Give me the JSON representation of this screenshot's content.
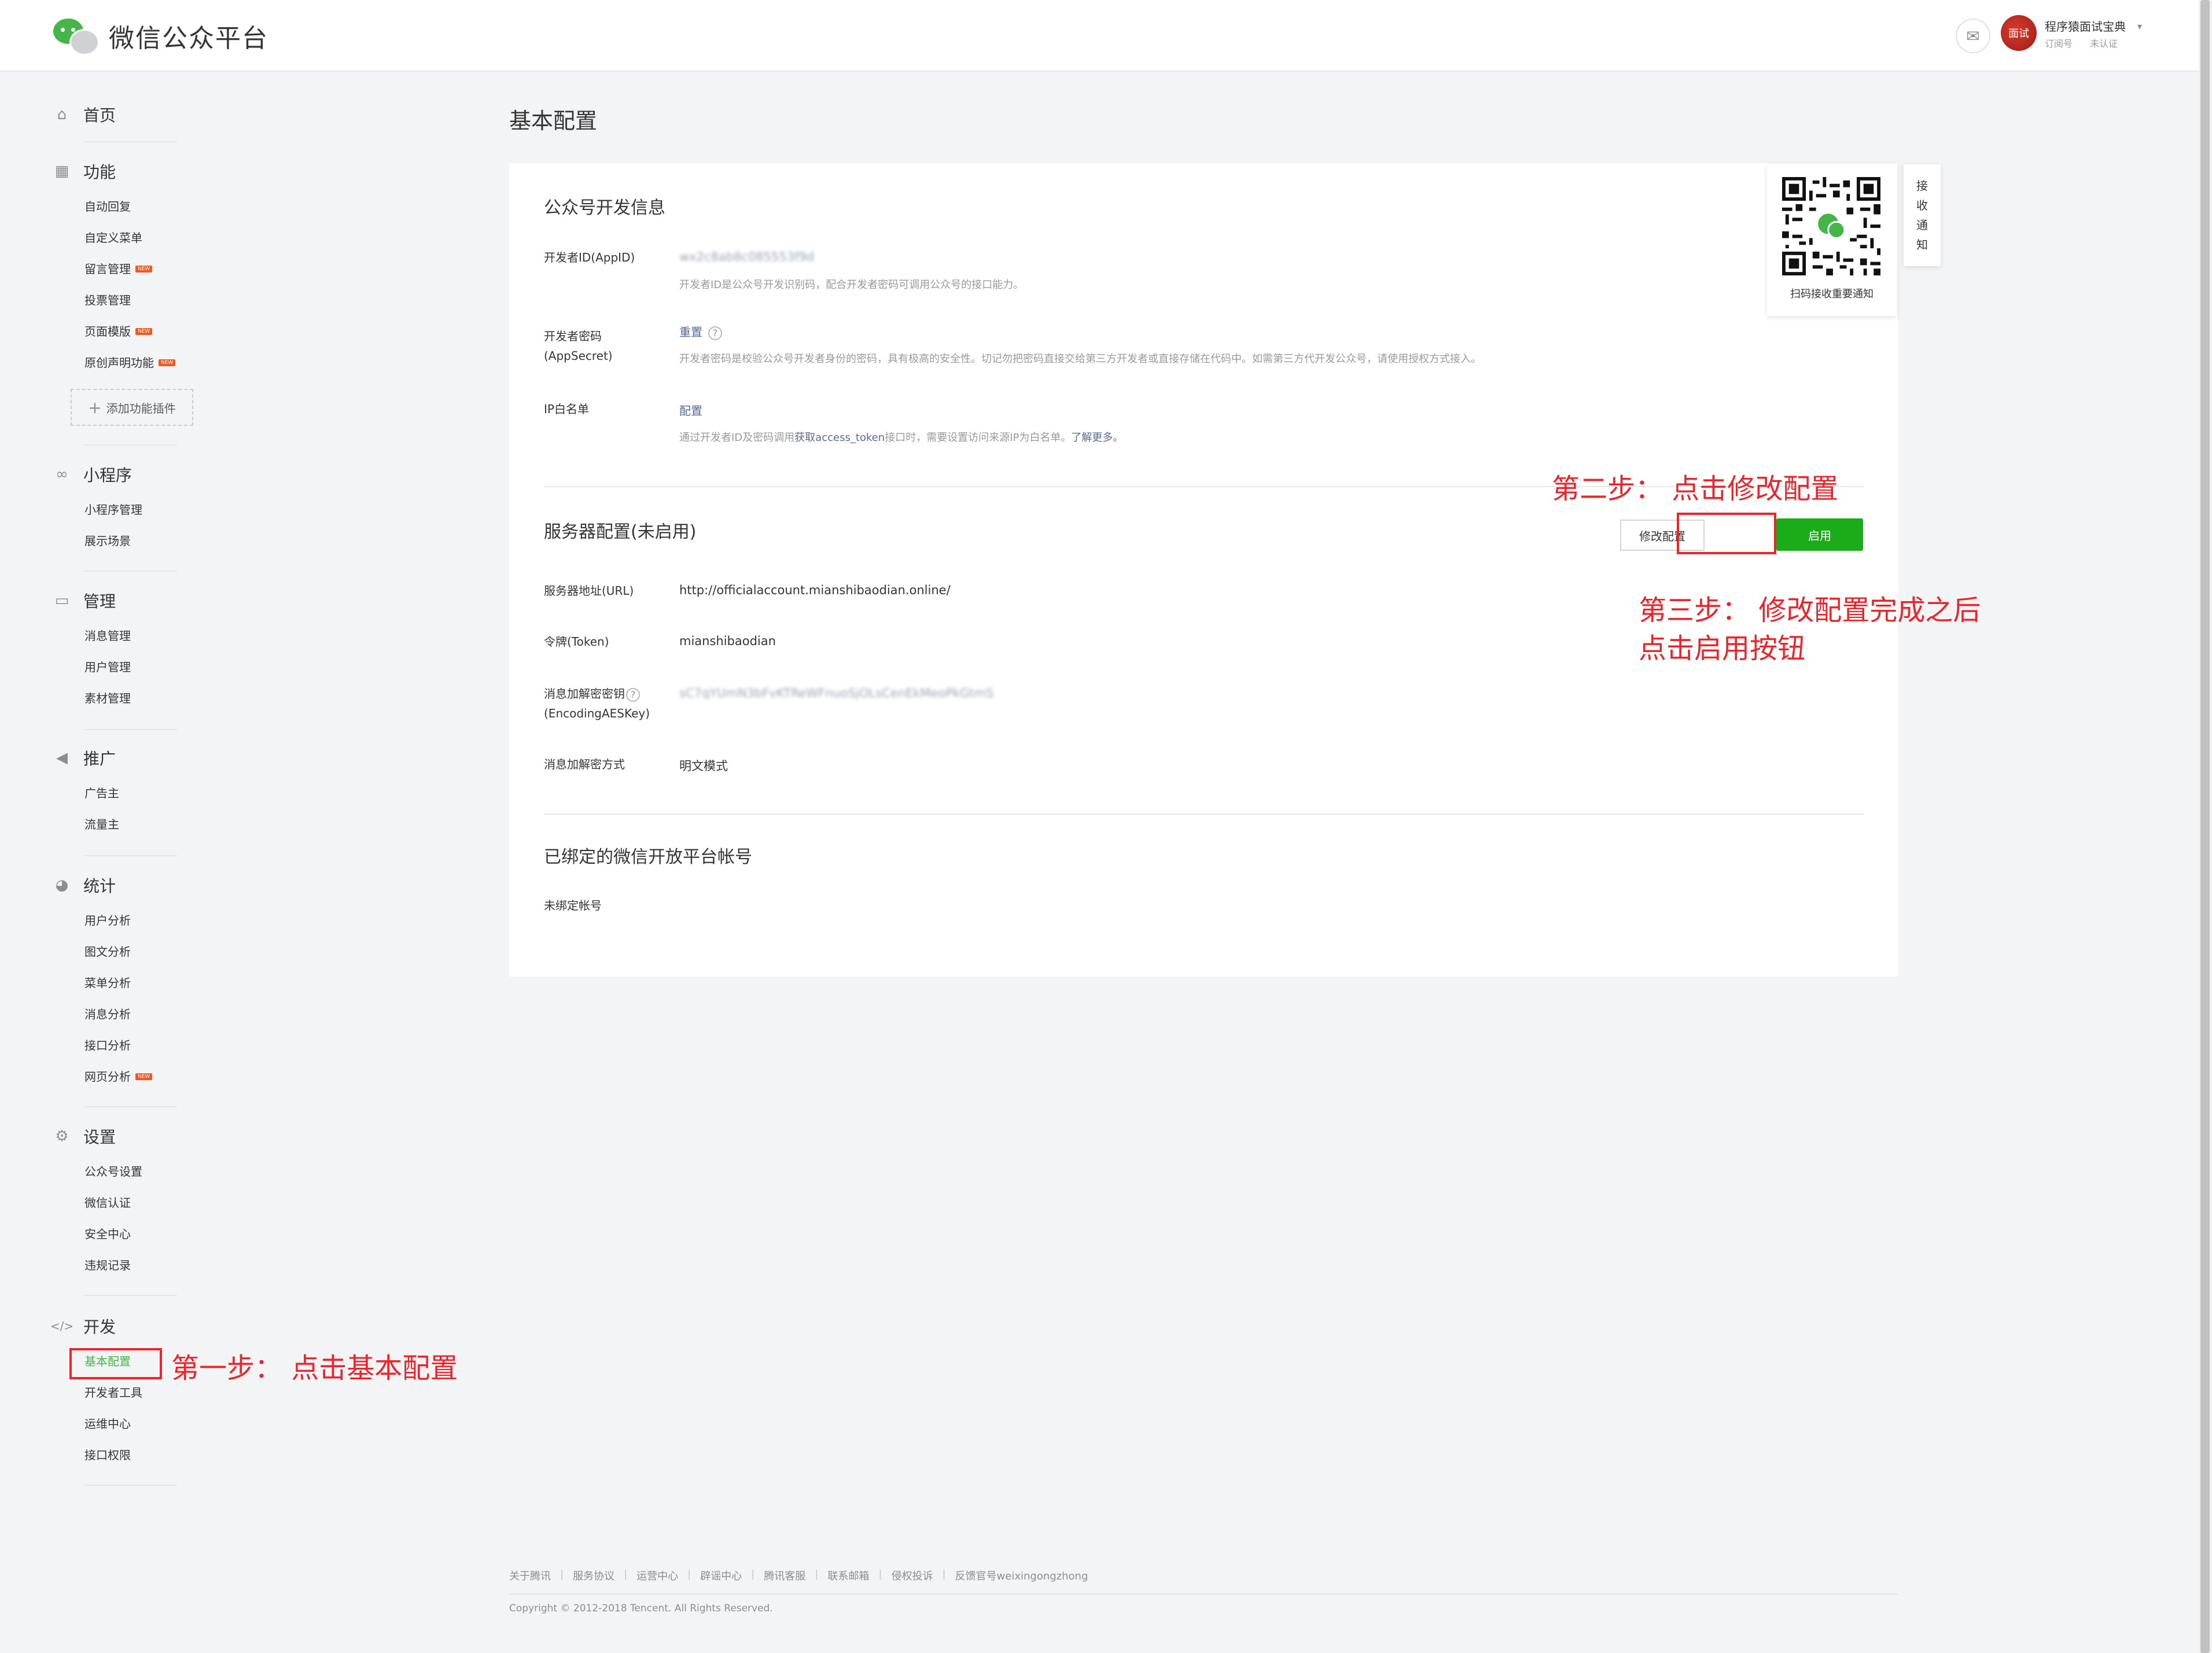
{
  "header": {
    "logo_text": "微信公众平台",
    "account": {
      "name": "程序猿面试宝典",
      "type": "订阅号",
      "verify_status": "未认证",
      "avatar_text": "面试"
    }
  },
  "sidebar": {
    "home": "首页",
    "function": {
      "label": "功能",
      "items": [
        "自动回复",
        "自定义菜单",
        "留言管理",
        "投票管理",
        "页面模版",
        "原创声明功能"
      ],
      "add_plugin": "添加功能插件"
    },
    "miniprogram": {
      "label": "小程序",
      "items": [
        "小程序管理",
        "展示场景"
      ]
    },
    "manage": {
      "label": "管理",
      "items": [
        "消息管理",
        "用户管理",
        "素材管理"
      ]
    },
    "promote": {
      "label": "推广",
      "items": [
        "广告主",
        "流量主"
      ]
    },
    "stats": {
      "label": "统计",
      "items": [
        "用户分析",
        "图文分析",
        "菜单分析",
        "消息分析",
        "接口分析",
        "网页分析"
      ]
    },
    "settings": {
      "label": "设置",
      "items": [
        "公众号设置",
        "微信认证",
        "安全中心",
        "违规记录"
      ]
    },
    "develop": {
      "label": "开发",
      "items": [
        "基本配置",
        "开发者工具",
        "运维中心",
        "接口权限"
      ]
    },
    "new_badge": "NEW"
  },
  "main": {
    "title": "基本配置",
    "dev_info": {
      "title": "公众号开发信息",
      "appid_label": "开发者ID(AppID)",
      "appid_value": "wx2c8ab8c085553f9d",
      "appid_tip": "开发者ID是公众号开发识别码，配合开发者密码可调用公众号的接口能力。",
      "secret_label_1": "开发者密码",
      "secret_label_2": "(AppSecret)",
      "secret_action": "重置",
      "secret_tip": "开发者密码是校验公众号开发者身份的密码，具有极高的安全性。切记勿把密码直接交给第三方开发者或直接存储在代码中。如需第三方代开发公众号，请使用授权方式接入。",
      "ip_label": "IP白名单",
      "ip_action": "配置",
      "ip_tip_1": "通过开发者ID及密码调用",
      "ip_tip_link": "获取access_token",
      "ip_tip_2": "接口时，需要设置访问来源IP为白名单。",
      "ip_tip_more": "了解更多。"
    },
    "server": {
      "title": "服务器配置(未启用)",
      "edit_button": "修改配置",
      "enable_button": "启用",
      "url_label": "服务器地址(URL)",
      "url_value": "http://officialaccount.mianshibaodian.online/",
      "token_label": "令牌(Token)",
      "token_value": "mianshibaodian",
      "aes_label_1": "消息加解密密钥",
      "aes_label_2": "(EncodingAESKey)",
      "aes_value": "sC7qYUmN3bFvKTReWFnuoSjOLsCenEkMeoPkGtmS",
      "mode_label": "消息加解密方式",
      "mode_value": "明文模式"
    },
    "open_platform": {
      "title": "已绑定的微信开放平台帐号",
      "value": "未绑定帐号"
    }
  },
  "qr_panel": {
    "caption": "扫码接收重要通知",
    "tab_chars": [
      "接",
      "收",
      "通",
      "知"
    ]
  },
  "annotations": {
    "step1": "第一步： 点击基本配置",
    "step2": "第二步： 点击修改配置",
    "step3_line1": "第三步： 修改配置完成之后",
    "step3_line2": "点击启用按钮",
    "color": "#e8262c"
  },
  "footer": {
    "links": [
      "关于腾讯",
      "服务协议",
      "运营中心",
      "辟谣中心",
      "腾讯客服",
      "联系邮箱",
      "侵权投诉",
      "反馈官号weixingongzhong"
    ],
    "copyright": "Copyright © 2012-2018 Tencent. All Rights Reserved."
  }
}
